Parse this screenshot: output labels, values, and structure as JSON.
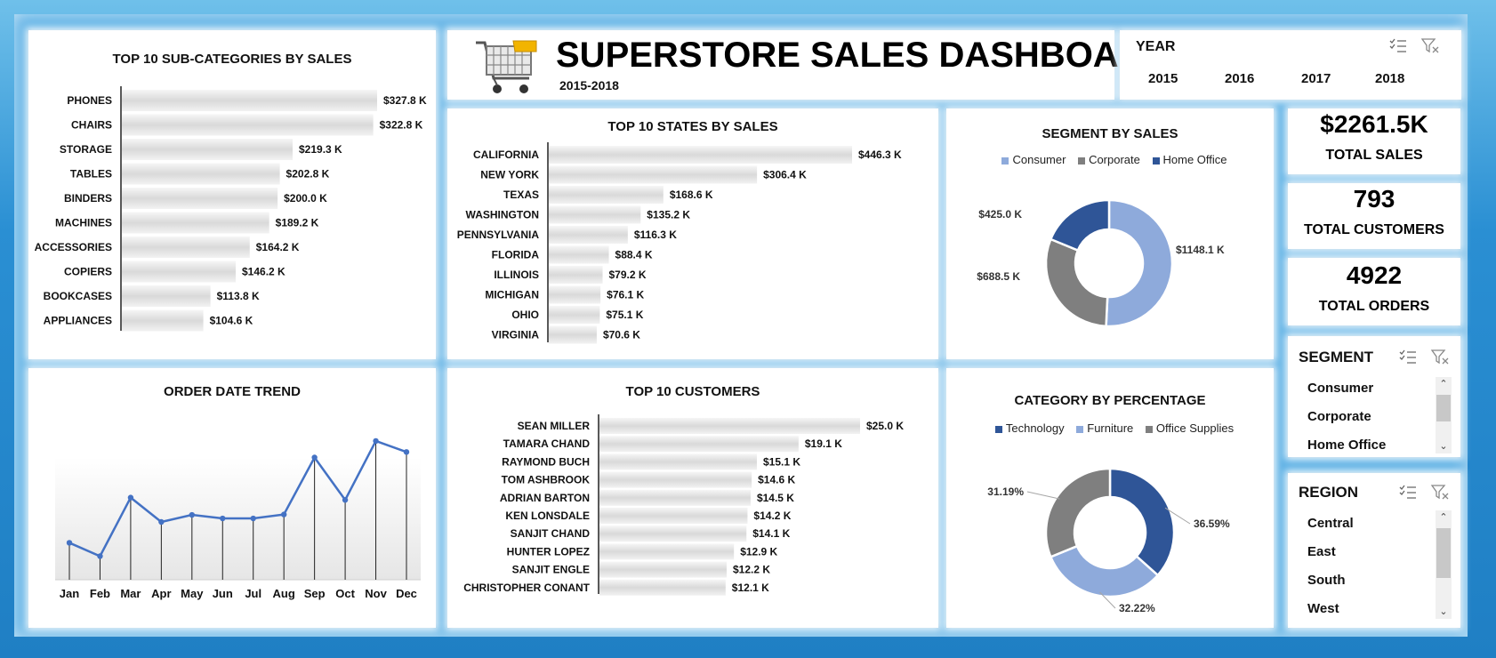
{
  "header": {
    "title": "SUPERSTORE SALES DASHBOARD",
    "subtitle": "2015-2018"
  },
  "year_slicer": {
    "title": "YEAR",
    "items": [
      "2015",
      "2016",
      "2017",
      "2018"
    ]
  },
  "kpis": [
    {
      "value": "$2261.5K",
      "label": "TOTAL SALES"
    },
    {
      "value": "793",
      "label": "TOTAL CUSTOMERS"
    },
    {
      "value": "4922",
      "label": "TOTAL ORDERS"
    }
  ],
  "segment_slicer": {
    "title": "SEGMENT",
    "items": [
      "Consumer",
      "Corporate",
      "Home Office"
    ]
  },
  "region_slicer": {
    "title": "REGION",
    "items": [
      "Central",
      "East",
      "South",
      "West"
    ]
  },
  "colors": {
    "consumer": "#8eaadb",
    "corporate": "#7f7f7f",
    "home_office": "#2f5597",
    "line": "#4472c4"
  },
  "chart_data": [
    {
      "id": "subcat",
      "type": "bar",
      "title": "TOP 10 SUB-CATEGORIES BY SALES",
      "categories": [
        "PHONES",
        "CHAIRS",
        "STORAGE",
        "TABLES",
        "BINDERS",
        "MACHINES",
        "ACCESSORIES",
        "COPIERS",
        "BOOKCASES",
        "APPLIANCES"
      ],
      "values": [
        327.8,
        322.8,
        219.3,
        202.8,
        200.0,
        189.2,
        164.2,
        146.2,
        113.8,
        104.6
      ],
      "labels": [
        "$327.8 K",
        "$322.8 K",
        "$219.3 K",
        "$202.8 K",
        "$200.0 K",
        "$189.2 K",
        "$164.2 K",
        "$146.2 K",
        "$113.8 K",
        "$104.6 K"
      ]
    },
    {
      "id": "states",
      "type": "bar",
      "title": "TOP 10 STATES BY SALES",
      "categories": [
        "CALIFORNIA",
        "NEW YORK",
        "TEXAS",
        "WASHINGTON",
        "PENNSYLVANIA",
        "FLORIDA",
        "ILLINOIS",
        "MICHIGAN",
        "OHIO",
        "VIRGINIA"
      ],
      "values": [
        446.3,
        306.4,
        168.6,
        135.2,
        116.3,
        88.4,
        79.2,
        76.1,
        75.1,
        70.6
      ],
      "labels": [
        "$446.3 K",
        "$306.4 K",
        "$168.6 K",
        "$135.2 K",
        "$116.3 K",
        "$88.4 K",
        "$79.2 K",
        "$76.1 K",
        "$75.1 K",
        "$70.6 K"
      ]
    },
    {
      "id": "customers",
      "type": "bar",
      "title": "TOP 10 CUSTOMERS",
      "categories": [
        "SEAN MILLER",
        "TAMARA CHAND",
        "RAYMOND BUCH",
        "TOM ASHBROOK",
        "ADRIAN BARTON",
        "KEN LONSDALE",
        "SANJIT CHAND",
        "HUNTER LOPEZ",
        "SANJIT ENGLE",
        "CHRISTOPHER CONANT"
      ],
      "values": [
        25.0,
        19.1,
        15.1,
        14.6,
        14.5,
        14.2,
        14.1,
        12.9,
        12.2,
        12.1
      ],
      "labels": [
        "$25.0 K",
        "$19.1 K",
        "$15.1 K",
        "$14.6 K",
        "$14.5 K",
        "$14.2 K",
        "$14.1 K",
        "$12.9 K",
        "$12.2 K",
        "$12.1 K"
      ]
    },
    {
      "id": "trend",
      "type": "line",
      "title": "ORDER DATE TREND",
      "categories": [
        "Jan",
        "Feb",
        "Mar",
        "Apr",
        "May",
        "Jun",
        "Jul",
        "Aug",
        "Sep",
        "Oct",
        "Nov",
        "Dec"
      ],
      "values": [
        94,
        60,
        209,
        147,
        165,
        156,
        156,
        166,
        311,
        203,
        353,
        325
      ]
    },
    {
      "id": "segment",
      "type": "pie",
      "title": "SEGMENT BY SALES",
      "categories": [
        "Consumer",
        "Corporate",
        "Home Office"
      ],
      "values": [
        1148.1,
        688.5,
        425.0
      ],
      "labels": [
        "$1148.1 K",
        "$688.5 K",
        "$425.0 K"
      ],
      "colors": [
        "#8eaadb",
        "#7f7f7f",
        "#2f5597"
      ]
    },
    {
      "id": "category",
      "type": "pie",
      "title": "CATEGORY BY PERCENTAGE",
      "categories": [
        "Technology",
        "Furniture",
        "Office Supplies"
      ],
      "values": [
        36.59,
        32.22,
        31.19
      ],
      "labels": [
        "36.59%",
        "32.22%",
        "31.19%"
      ],
      "colors": [
        "#2f5597",
        "#8eaadb",
        "#7f7f7f"
      ]
    }
  ]
}
